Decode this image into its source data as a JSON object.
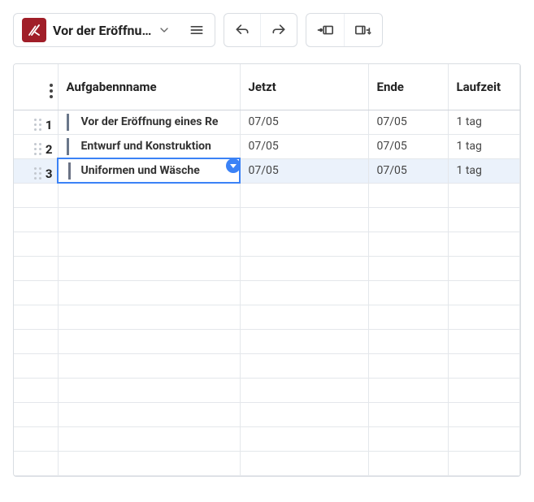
{
  "header": {
    "title": "Vor der Eröffnu…"
  },
  "columns": {
    "name": "Aufgabennname",
    "jetzt": "Jetzt",
    "ende": "Ende",
    "laufzeit": "Laufzeit"
  },
  "rows": [
    {
      "num": "1",
      "name": "Vor der Eröffnung eines Re",
      "jetzt": "07/05",
      "ende": "07/05",
      "laufzeit": "1 tag",
      "selected": false
    },
    {
      "num": "2",
      "name": "Entwurf und Konstruktion",
      "jetzt": "07/05",
      "ende": "07/05",
      "laufzeit": "1 tag",
      "selected": false
    },
    {
      "num": "3",
      "name": "Uniformen und Wäsche",
      "jetzt": "07/05",
      "ende": "07/05",
      "laufzeit": "1 tag",
      "selected": true
    }
  ],
  "empty_row_count": 12
}
